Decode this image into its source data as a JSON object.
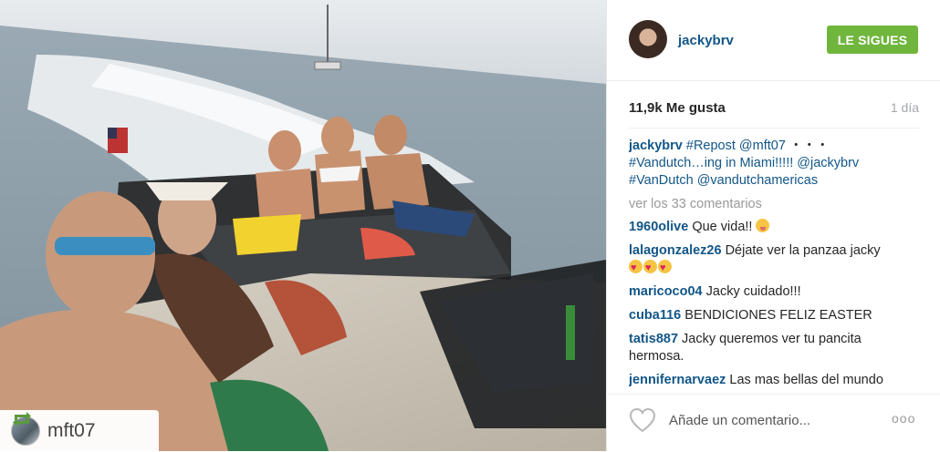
{
  "post": {
    "repost_username": "mft07"
  },
  "header": {
    "username": "jackybrv",
    "follow_label": "LE SIGUES"
  },
  "stats": {
    "likes": "11,9k Me gusta",
    "time": "1 día"
  },
  "caption": {
    "username": "jackybrv",
    "text_1": "#Repost @mft07",
    "text_2": "・・・",
    "text_3": "#Vandutch…ing in Miami!!!!! @jackybrv",
    "text_4": "#VanDutch @vandutchamericas"
  },
  "view_all_comments": "ver los 33 comentarios",
  "comments": [
    {
      "user": "1960olive",
      "text": "Que vida!!"
    },
    {
      "user": "lalagonzalez26",
      "text": "Déjate ver la panzaa jacky"
    },
    {
      "user": "maricoco04",
      "text": "Jacky cuidado!!!"
    },
    {
      "user": "cuba116",
      "text": "BENDICIONES FELIZ EASTER"
    },
    {
      "user": "tatis887",
      "text": "Jacky queremos ver tu pancita hermosa."
    },
    {
      "user": "jennifernarvaez",
      "text": "Las mas bellas del mundo"
    }
  ],
  "footer": {
    "comment_placeholder": "Añade un comentario...",
    "more_options": "ooo"
  },
  "colors": {
    "accent_link": "#125688",
    "follow_button": "#70b63d",
    "muted_text": "#a5a7aa"
  },
  "icons": [
    "repost-icon",
    "heart-icon",
    "more-options-icon"
  ]
}
